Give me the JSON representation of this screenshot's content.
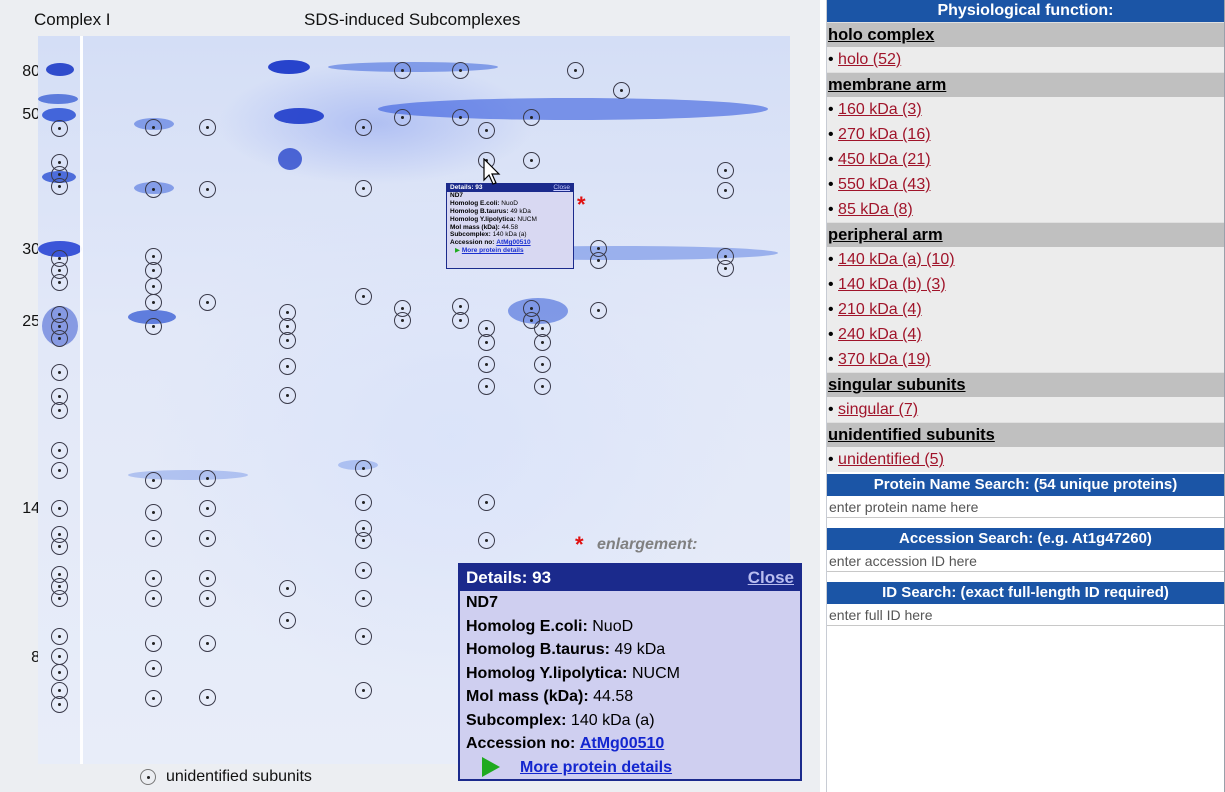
{
  "left": {
    "label_left": "Complex I",
    "label_center": "SDS-induced Subcomplexes",
    "mw_markers": [
      "80",
      "50",
      "30",
      "25",
      "14",
      "8"
    ],
    "enlargement_star": "*",
    "enlargement_label": "enlargement:",
    "legend_label": "unidentified subunits"
  },
  "mini_details": {
    "title": "Details: 93",
    "close": "Close",
    "name": "ND7",
    "ecoli_label": "Homolog E.coli:",
    "ecoli_value": "NuoD",
    "btaurus_label": "Homolog B.taurus:",
    "btaurus_value": "49 kDa",
    "ylipo_label": "Homolog Y.lipolytica:",
    "ylipo_value": "NUCM",
    "mass_label": "Mol mass (kDa):",
    "mass_value": "44.58",
    "subcomplex_label": "Subcomplex:",
    "subcomplex_value": "140 kDa (a)",
    "accession_label": "Accession no:",
    "accession_value": "AtMg00510",
    "more": "More protein details"
  },
  "details": {
    "title": "Details: 93",
    "close": "Close",
    "name": "ND7",
    "ecoli_label": "Homolog E.coli:",
    "ecoli_value": "NuoD",
    "btaurus_label": "Homolog B.taurus:",
    "btaurus_value": "49 kDa",
    "ylipo_label": "Homolog Y.lipolytica:",
    "ylipo_value": "NUCM",
    "mass_label": "Mol mass (kDa):",
    "mass_value": "44.58",
    "subcomplex_label": "Subcomplex:",
    "subcomplex_value": "140 kDa (a)",
    "accession_label": "Accession no:",
    "accession_value": "AtMg00510",
    "more": "More protein details"
  },
  "right": {
    "header": "Physiological function:",
    "groups": [
      {
        "title": "holo complex",
        "items": [
          "holo (52)"
        ]
      },
      {
        "title": "membrane arm",
        "items": [
          "160 kDa (3)",
          "270 kDa (16)",
          "450 kDa (21)",
          "550 kDa (43)",
          "85 kDa (8)"
        ]
      },
      {
        "title": "peripheral arm",
        "items": [
          "140 kDa (a) (10)",
          "140 kDa (b) (3)",
          "210 kDa (4)",
          "240 kDa (4)",
          "370 kDa (19)"
        ]
      },
      {
        "title": "singular subunits",
        "items": [
          "singular (7)"
        ]
      },
      {
        "title": "unidentified subunits",
        "items": [
          "unidentified (5)"
        ]
      }
    ],
    "name_search_title": "Protein Name Search: (54 unique proteins)",
    "name_search_placeholder": "enter protein name here",
    "accession_search_title": "Accession Search: (e.g. At1g47260)",
    "accession_search_placeholder": "enter accession ID here",
    "id_search_title": "ID Search: (exact full-length ID required)",
    "id_search_placeholder": "enter full ID here"
  },
  "colors": {
    "header_blue": "#1b55a6",
    "popup_blue": "#1b2a8c",
    "link_red": "#a0142a",
    "star_red": "#e01010",
    "arrow_green": "#1faa1f"
  }
}
